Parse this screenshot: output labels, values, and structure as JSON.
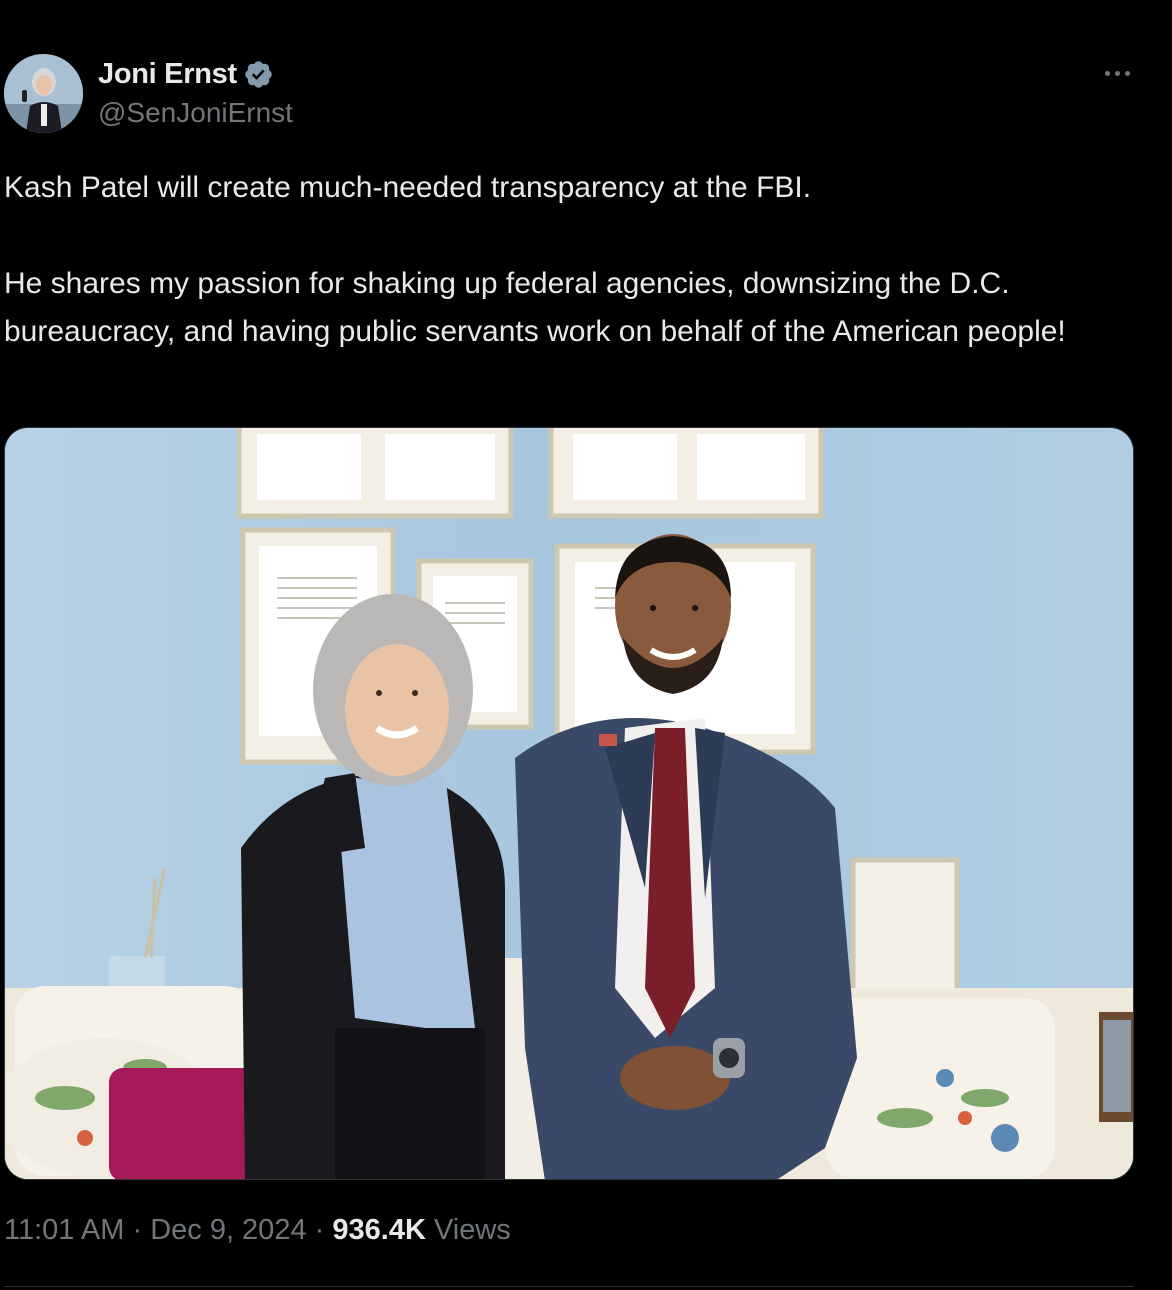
{
  "author": {
    "display_name": "Joni Ernst",
    "handle": "@SenJoniErnst",
    "verified_icon": "verified-badge-icon",
    "avatar_icon": "avatar"
  },
  "tweet": {
    "paragraphs": [
      "Kash Patel will create much-needed transparency at the FBI.",
      "He shares my passion for shaking up federal agencies, downsizing the D.C. bureaucracy, and having public servants work on behalf of the American people!"
    ]
  },
  "media": {
    "type": "photo"
  },
  "meta": {
    "time": "11:01 AM",
    "separator": "·",
    "date": "Dec 9, 2024",
    "views_count": "936.4K",
    "views_label": "Views"
  },
  "colors": {
    "background": "#000000",
    "text_primary": "#e7e9ea",
    "text_secondary": "#71767b",
    "verified": "#829aab",
    "divider": "#2f3336"
  }
}
